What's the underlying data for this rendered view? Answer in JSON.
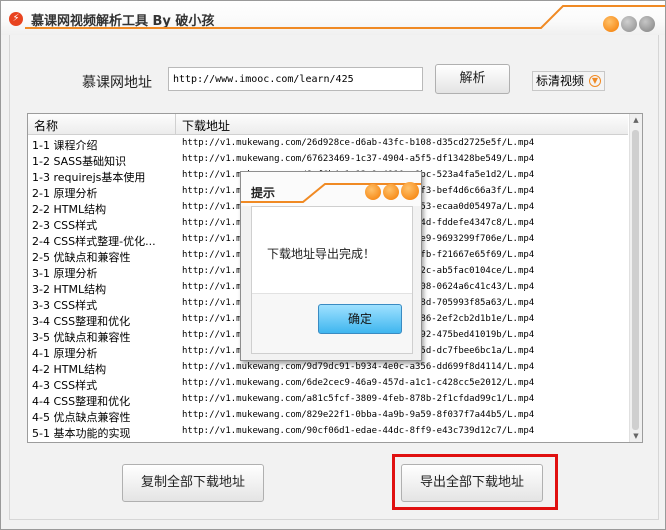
{
  "window": {
    "title": "慕课网视频解析工具 By 破小孩"
  },
  "form": {
    "url_label": "慕课网地址",
    "url_value": "http://www.imooc.com/learn/425",
    "parse_label": "解析",
    "quality_label": "标清视频"
  },
  "list": {
    "headers": {
      "name": "名称",
      "url": "下载地址"
    },
    "rows": [
      {
        "name": "1-1 课程介绍",
        "url": "http://v1.mukewang.com/26d928ce-d6ab-43fc-b108-d35cd2725e5f/L.mp4"
      },
      {
        "name": "1-2 SASS基础知识",
        "url": "http://v1.mukewang.com/67623469-1c37-4904-a5f5-df13428be549/L.mp4"
      },
      {
        "name": "1-3 requirejs基本使用",
        "url": "http://v1.mukewang.com/8ef6b4a1-12c9-4910-a1bc-523a4fa5e1d2/L.mp4"
      },
      {
        "name": "2-1 原理分析",
        "url": "http://v1.mukewang.com/0c56e412-5d8b-4c33-a4f3-bef4d6c66a3f/L.mp4"
      },
      {
        "name": "2-2 HTML结构",
        "url": "http://v1.mukewang.com/1b93d7e5-7a2f-4d16-ab53-ecaa0d05497a/L.mp4"
      },
      {
        "name": "2-3 CSS样式",
        "url": "http://v1.mukewang.com/5f0e8a23-9c41-4b7e-874d-fddefe4347c8/L.mp4"
      },
      {
        "name": "2-4 CSS样式整理-优化...",
        "url": "http://v1.mukewang.com/a2d71c84-3e05-4f9a-96e9-9693299f706e/L.mp4"
      },
      {
        "name": "2-5 优缺点和兼容性",
        "url": "http://v1.mukewang.com/7c3e9b10-45d6-4a28-98fb-f21667e65f69/L.mp4"
      },
      {
        "name": "3-1 原理分析",
        "url": "http://v1.mukewang.com/e91f2d57-6b08-4c7a-ac2c-ab5fac0104ce/L.mp4"
      },
      {
        "name": "3-2 HTML结构",
        "url": "http://v1.mukewang.com/3d4a6e92-8f17-4b05-8908-0624a6c41c43/L.mp4"
      },
      {
        "name": "3-3 CSS样式",
        "url": "http://v1.mukewang.com/b67c0f38-2a94-4d51-888d-705993f85a63/L.mp4"
      },
      {
        "name": "3-4 CSS整理和优化",
        "url": "http://v1.mukewang.com/4f8d1a67-c3e2-4970-9186-2ef2cb2d1b1e/L.mp4"
      },
      {
        "name": "3-5 优缺点和兼容性",
        "url": "http://v1.mukewang.com/9e2b5c71-0d46-4f83-9a92-475bed41019b/L.mp4"
      },
      {
        "name": "4-1 原理分析",
        "url": "http://v1.mukewang.com/6a1f3e08-b7c5-4d29-a65d-dc7fbee6bc1a/L.mp4"
      },
      {
        "name": "4-2 HTML结构",
        "url": "http://v1.mukewang.com/9d79dc91-b934-4e0c-a356-dd699f8d4114/L.mp4"
      },
      {
        "name": "4-3 CSS样式",
        "url": "http://v1.mukewang.com/6de2cec9-46a9-457d-a1c1-c428cc5e2012/L.mp4"
      },
      {
        "name": "4-4 CSS整理和优化",
        "url": "http://v1.mukewang.com/a81c5fcf-3809-4feb-878b-2f1cfdad99c1/L.mp4"
      },
      {
        "name": "4-5 优点缺点兼容性",
        "url": "http://v1.mukewang.com/829e22f1-0bba-4a9b-9a59-8f037f7a44b5/L.mp4"
      },
      {
        "name": "5-1 基本功能的实现",
        "url": "http://v1.mukewang.com/90cf06d1-edae-44dc-8ff9-e43c739d12c7/L.mp4"
      }
    ]
  },
  "actions": {
    "copy_all_label": "复制全部下载地址",
    "export_all_label": "导出全部下载地址"
  },
  "dialog": {
    "title": "提示",
    "message": "下载地址导出完成！",
    "ok_label": "确定"
  },
  "icons": {
    "app": "lightning-icon",
    "dropdown": "chevron-down-icon"
  },
  "colors": {
    "accent": "#f47a00",
    "highlight": "#e01010",
    "ok_button": "#3fb6ef"
  }
}
